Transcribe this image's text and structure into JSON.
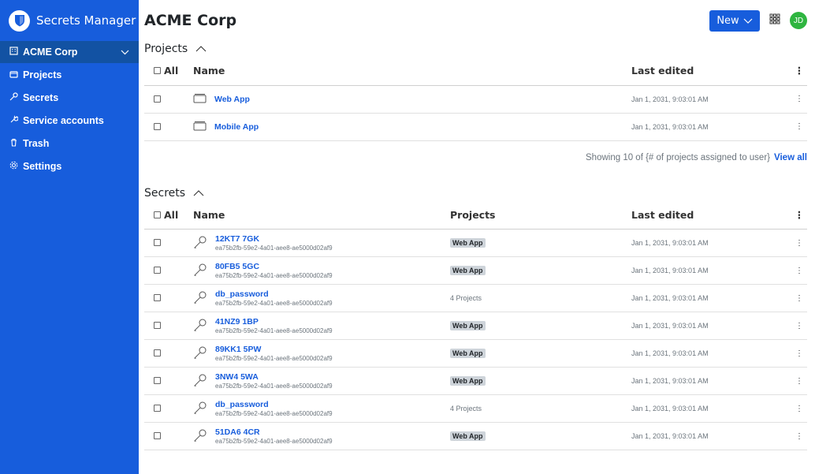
{
  "sidebar": {
    "brand": "Secrets Manager",
    "org": "ACME Corp",
    "items": [
      {
        "label": "Projects",
        "icon": "folder-icon"
      },
      {
        "label": "Secrets",
        "icon": "key-icon"
      },
      {
        "label": "Service accounts",
        "icon": "wrench-icon"
      },
      {
        "label": "Trash",
        "icon": "trash-icon"
      },
      {
        "label": "Settings",
        "icon": "gear-icon"
      }
    ]
  },
  "header": {
    "title": "ACME Corp",
    "new_label": "New",
    "avatar": "JD"
  },
  "projects": {
    "title": "Projects",
    "col_all": "All",
    "col_name": "Name",
    "col_edited": "Last edited",
    "rows": [
      {
        "name": "Web App",
        "edited": "Jan 1, 2031, 9:03:01 AM"
      },
      {
        "name": "Mobile App",
        "edited": "Jan 1, 2031, 9:03:01 AM"
      }
    ],
    "showing": "Showing 10 of {# of projects assigned to user}",
    "view_all": "View all"
  },
  "secrets": {
    "title": "Secrets",
    "col_all": "All",
    "col_name": "Name",
    "col_projects": "Projects",
    "col_edited": "Last edited",
    "rows": [
      {
        "name": "12KT7 7GK",
        "id": "ea75b2fb-59e2-4a01-aee8-ae5000d02af9",
        "project": "Web App",
        "badge": true,
        "edited": "Jan 1, 2031, 9:03:01 AM"
      },
      {
        "name": "80FB5 5GC",
        "id": "ea75b2fb-59e2-4a01-aee8-ae5000d02af9",
        "project": "Web App",
        "badge": true,
        "edited": "Jan 1, 2031, 9:03:01 AM"
      },
      {
        "name": "db_password",
        "id": "ea75b2fb-59e2-4a01-aee8-ae5000d02af9",
        "project": "4 Projects",
        "badge": false,
        "edited": "Jan 1, 2031, 9:03:01 AM"
      },
      {
        "name": "41NZ9 1BP",
        "id": "ea75b2fb-59e2-4a01-aee8-ae5000d02af9",
        "project": "Web App",
        "badge": true,
        "edited": "Jan 1, 2031, 9:03:01 AM"
      },
      {
        "name": "89KK1 5PW",
        "id": "ea75b2fb-59e2-4a01-aee8-ae5000d02af9",
        "project": "Web App",
        "badge": true,
        "edited": "Jan 1, 2031, 9:03:01 AM"
      },
      {
        "name": "3NW4 5WA",
        "id": "ea75b2fb-59e2-4a01-aee8-ae5000d02af9",
        "project": "Web App",
        "badge": true,
        "edited": "Jan 1, 2031, 9:03:01 AM"
      },
      {
        "name": "db_password",
        "id": "ea75b2fb-59e2-4a01-aee8-ae5000d02af9",
        "project": "4 Projects",
        "badge": false,
        "edited": "Jan 1, 2031, 9:03:01 AM"
      },
      {
        "name": "51DA6 4CR",
        "id": "ea75b2fb-59e2-4a01-aee8-ae5000d02af9",
        "project": "Web App",
        "badge": true,
        "edited": "Jan 1, 2031, 9:03:01 AM"
      }
    ]
  },
  "colors": {
    "brand": "#175ddc",
    "org_bg": "#1252a3",
    "avatar": "#2fb540"
  }
}
